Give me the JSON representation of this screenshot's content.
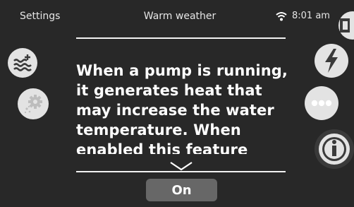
{
  "header": {
    "left_label": "Settings",
    "title": "Warm weather",
    "time": "8:01 am"
  },
  "icons": {
    "left": [
      "water-heater-plus-icon",
      "gear-sparkle-icon"
    ],
    "right": [
      "exit-door-icon",
      "lightning-bolt-icon",
      "more-options-icon",
      "info-icon"
    ],
    "status": [
      "wifi-icon"
    ]
  },
  "content": {
    "description": "When a pump is running, it generates heat that may increase the water temperature. When enabled this feature allows filtering"
  },
  "toggle": {
    "label": "On"
  },
  "colors": {
    "background": "#282828",
    "button": "#676767",
    "icon_circle": "#e3e3e3",
    "icon_glyph": "#3a3a3a"
  }
}
